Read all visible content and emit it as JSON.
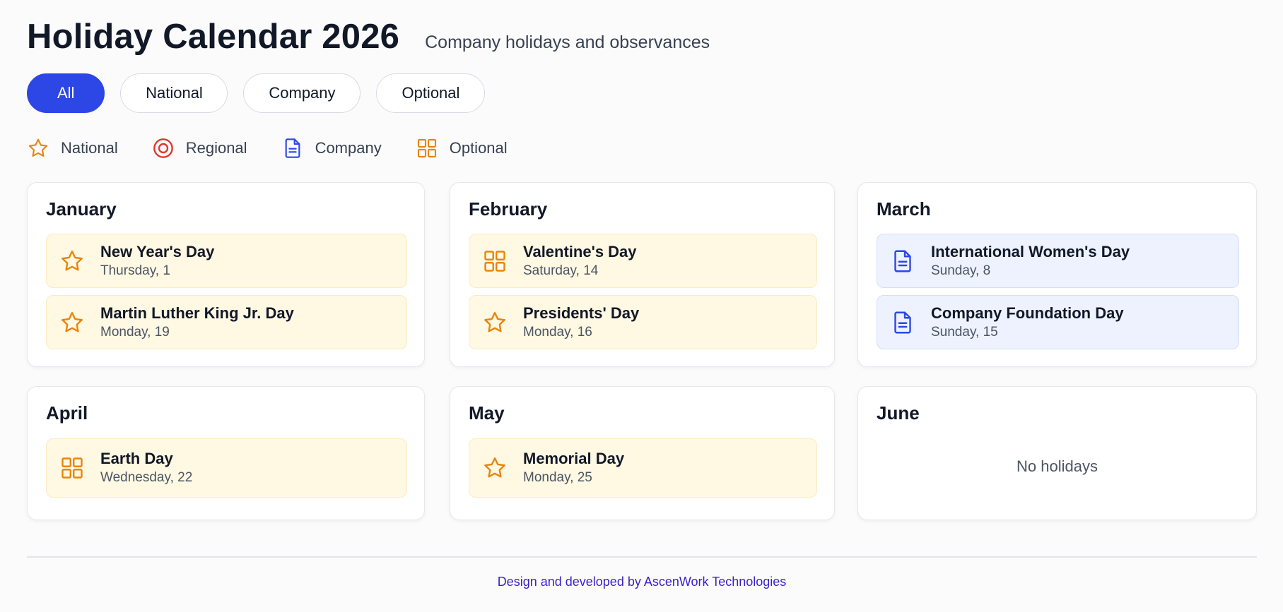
{
  "header": {
    "title": "Holiday Calendar 2026",
    "subtitle": "Company holidays and observances"
  },
  "filters": [
    {
      "label": "All",
      "active": true
    },
    {
      "label": "National",
      "active": false
    },
    {
      "label": "Company",
      "active": false
    },
    {
      "label": "Optional",
      "active": false
    }
  ],
  "legend": [
    {
      "label": "National",
      "icon": "star-icon",
      "color": "#e8850c"
    },
    {
      "label": "Regional",
      "icon": "target-icon",
      "color": "#dc3a2f"
    },
    {
      "label": "Company",
      "icon": "document-icon",
      "color": "#2c47e6"
    },
    {
      "label": "Optional",
      "icon": "grid-icon",
      "color": "#e8850c"
    }
  ],
  "months": [
    {
      "name": "January",
      "holidays": [
        {
          "name": "New Year's Day",
          "date": "Thursday, 1",
          "type": "national"
        },
        {
          "name": "Martin Luther King Jr. Day",
          "date": "Monday, 19",
          "type": "national"
        }
      ]
    },
    {
      "name": "February",
      "holidays": [
        {
          "name": "Valentine's Day",
          "date": "Saturday, 14",
          "type": "optional"
        },
        {
          "name": "Presidents' Day",
          "date": "Monday, 16",
          "type": "national"
        }
      ]
    },
    {
      "name": "March",
      "holidays": [
        {
          "name": "International Women's Day",
          "date": "Sunday, 8",
          "type": "company"
        },
        {
          "name": "Company Foundation Day",
          "date": "Sunday, 15",
          "type": "company"
        }
      ]
    },
    {
      "name": "April",
      "holidays": [
        {
          "name": "Earth Day",
          "date": "Wednesday, 22",
          "type": "optional"
        }
      ]
    },
    {
      "name": "May",
      "holidays": [
        {
          "name": "Memorial Day",
          "date": "Monday, 25",
          "type": "national"
        }
      ]
    },
    {
      "name": "June",
      "holidays": [],
      "empty_text": "No holidays"
    }
  ],
  "footer": {
    "text": "Design and developed by AscenWork Technologies"
  },
  "colors": {
    "accent": "#2c47e6",
    "national": "#e8850c",
    "regional": "#dc3a2f",
    "company": "#2c47e6",
    "optional": "#e8850c"
  }
}
